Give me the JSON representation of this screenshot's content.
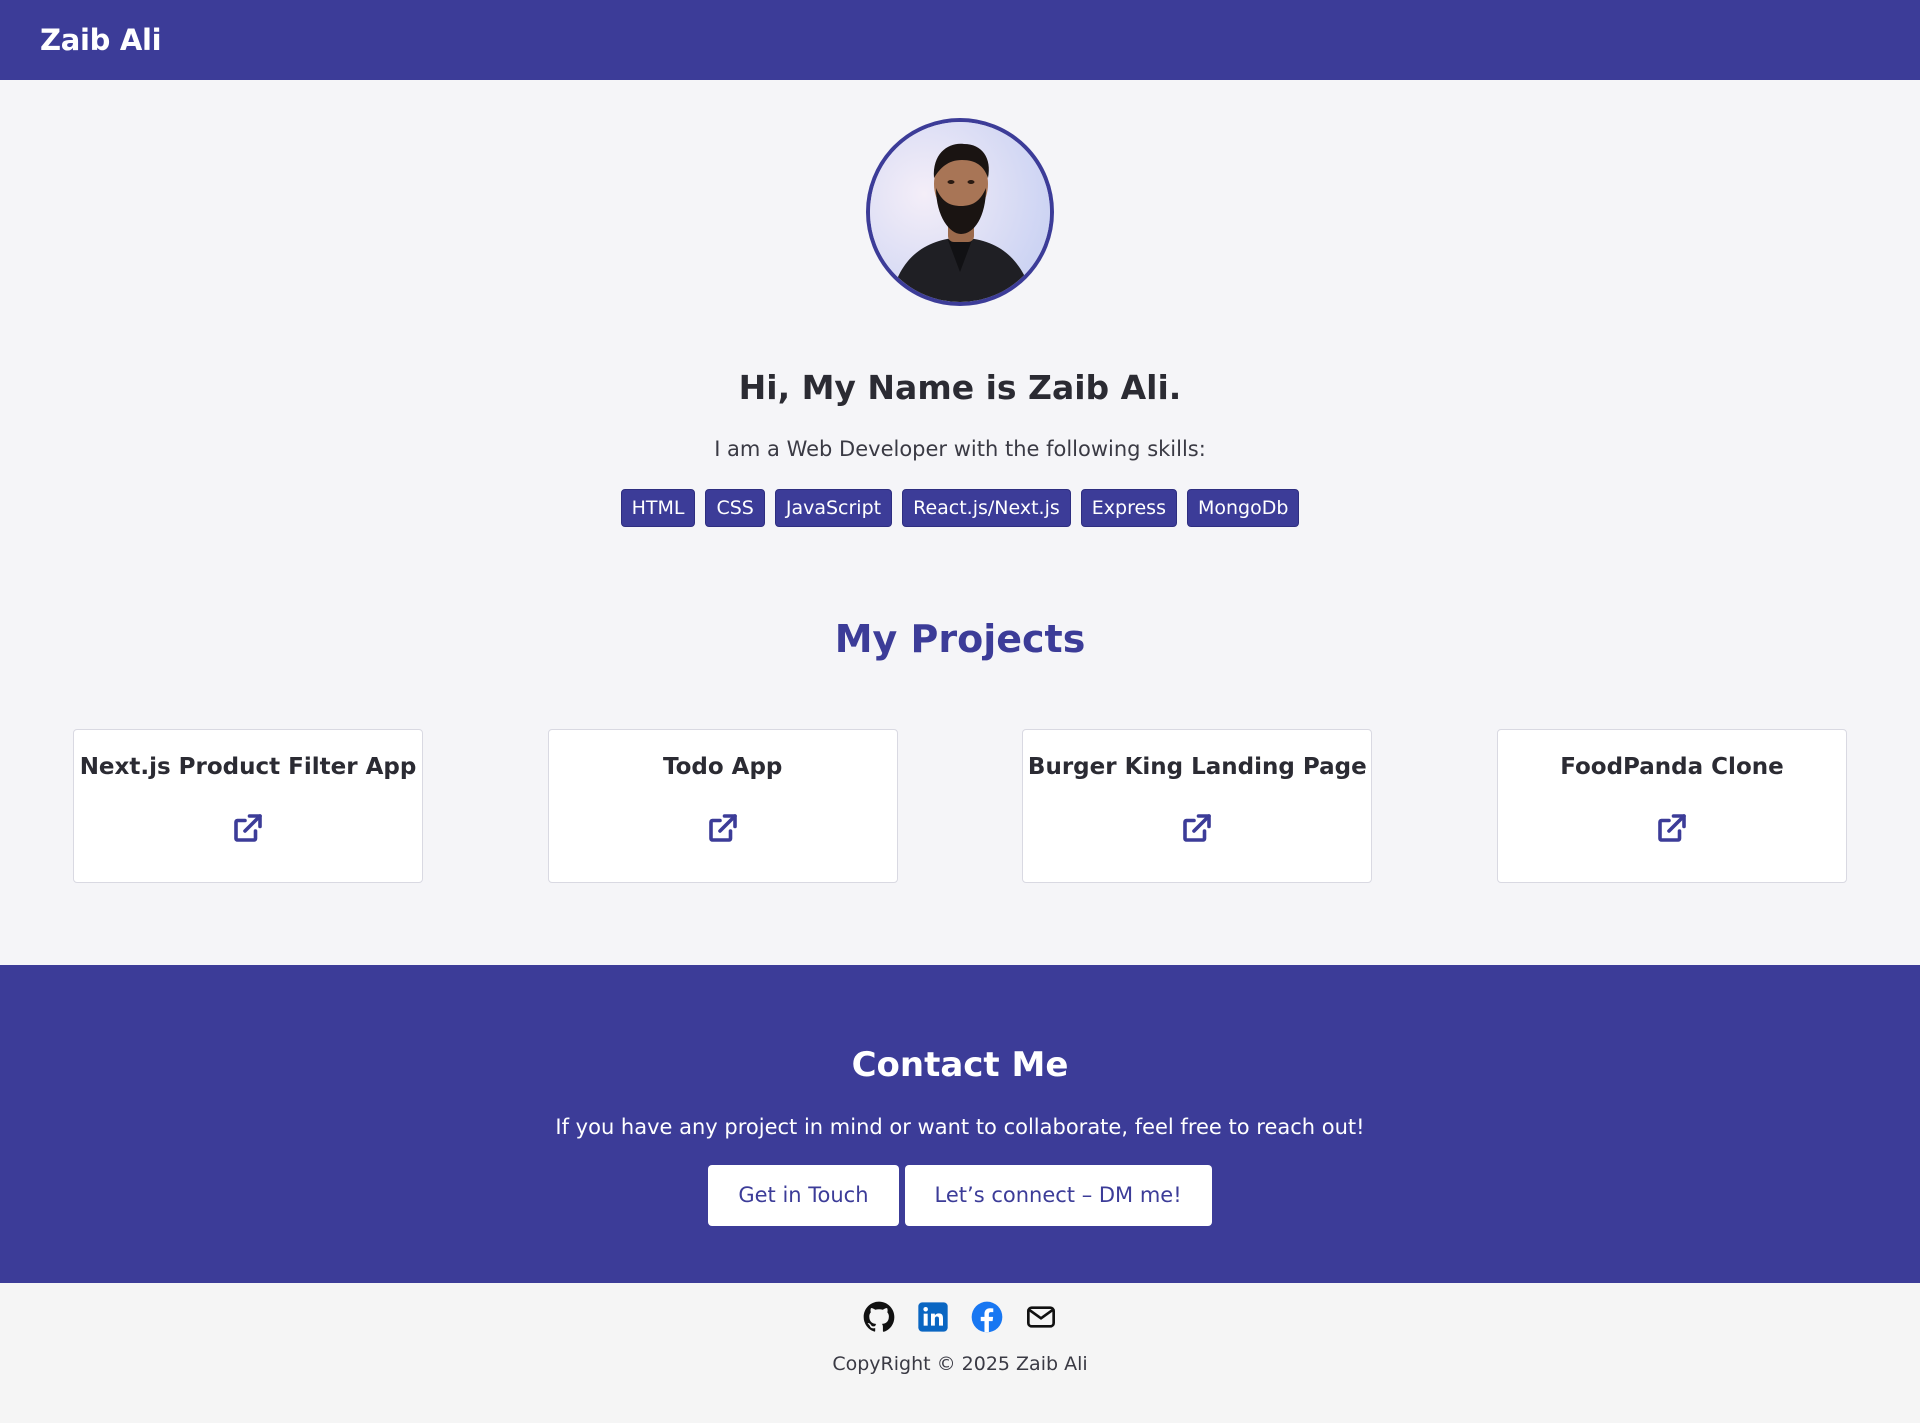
{
  "nav": {
    "brand": "Zaib Ali"
  },
  "hero": {
    "heading": "Hi, My Name is Zaib Ali.",
    "intro": "I am a Web Developer with the following skills:",
    "skills": [
      "HTML",
      "CSS",
      "JavaScript",
      "React.js/Next.js",
      "Express",
      "MongoDb"
    ]
  },
  "projects": {
    "title": "My Projects",
    "items": [
      {
        "title": "Next.js Product Filter App",
        "icon": "external-link-icon"
      },
      {
        "title": "Todo App",
        "icon": "external-link-icon"
      },
      {
        "title": "Burger King Landing Page",
        "icon": "external-link-icon"
      },
      {
        "title": "FoodPanda Clone",
        "icon": "external-link-icon"
      }
    ]
  },
  "contact": {
    "title": "Contact Me",
    "text": "If you have any project in mind or want to collaborate, feel free to reach out!",
    "primary_button": "Get in Touch",
    "secondary_button": "Let’s connect – DM me!"
  },
  "footer": {
    "socials": [
      "github-icon",
      "linkedin-icon",
      "facebook-icon",
      "email-icon"
    ],
    "copyright": "CopyRight © 2025 Zaib Ali"
  },
  "colors": {
    "primary": "#3c3c98",
    "background": "#f5f5f8",
    "linkedin": "#0a66c2",
    "facebook": "#1877f2"
  }
}
